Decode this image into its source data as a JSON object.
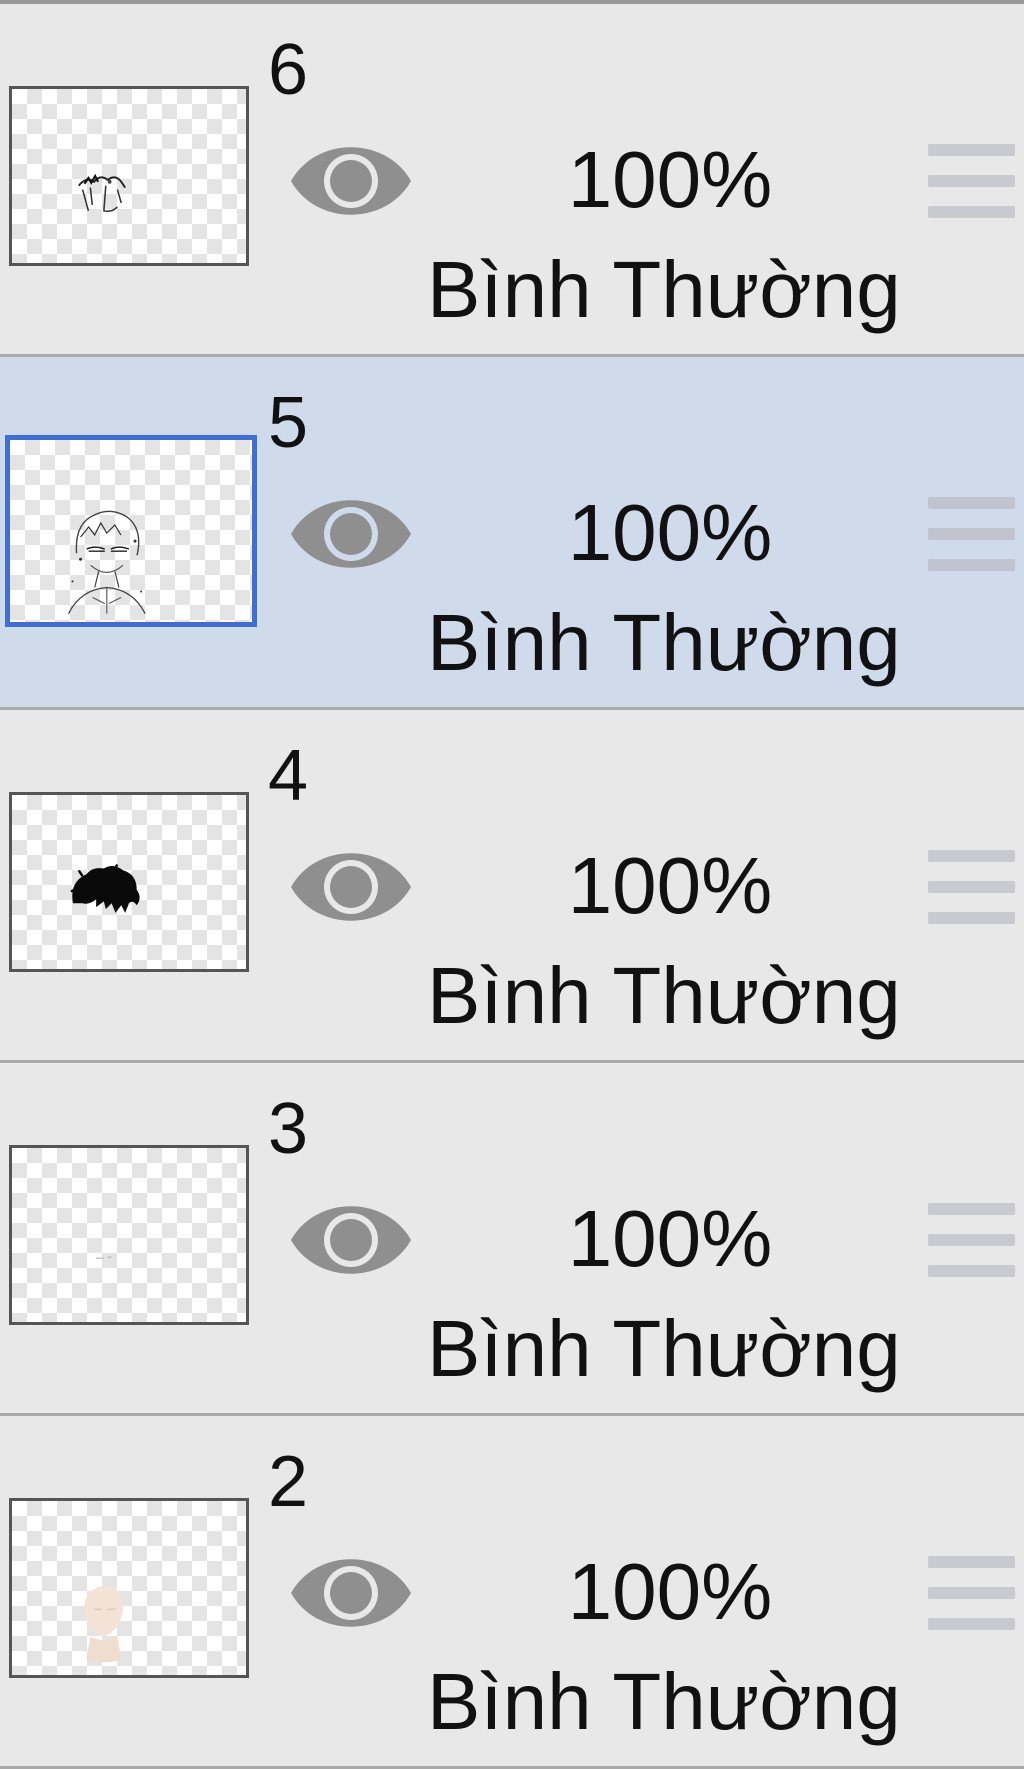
{
  "layers": [
    {
      "number": "6",
      "opacity": "100%",
      "blend_mode": "Bình Thường",
      "visible": true,
      "selected": false,
      "thumbnail": "small-sketch-fragment"
    },
    {
      "number": "5",
      "opacity": "100%",
      "blend_mode": "Bình Thường",
      "visible": true,
      "selected": true,
      "thumbnail": "character-lineart"
    },
    {
      "number": "4",
      "opacity": "100%",
      "blend_mode": "Bình Thường",
      "visible": true,
      "selected": false,
      "thumbnail": "black-hair-shape"
    },
    {
      "number": "3",
      "opacity": "100%",
      "blend_mode": "Bình Thường",
      "visible": true,
      "selected": false,
      "thumbnail": "nearly-empty"
    },
    {
      "number": "2",
      "opacity": "100%",
      "blend_mode": "Bình Thường",
      "visible": true,
      "selected": false,
      "thumbnail": "skin-tone-face"
    }
  ],
  "colors": {
    "row_background": "#e8e8e8",
    "selected_row_background": "#cfdbeb",
    "selected_thumb_border": "#3f6fd2",
    "eye_icon": "#8f8f8f"
  }
}
